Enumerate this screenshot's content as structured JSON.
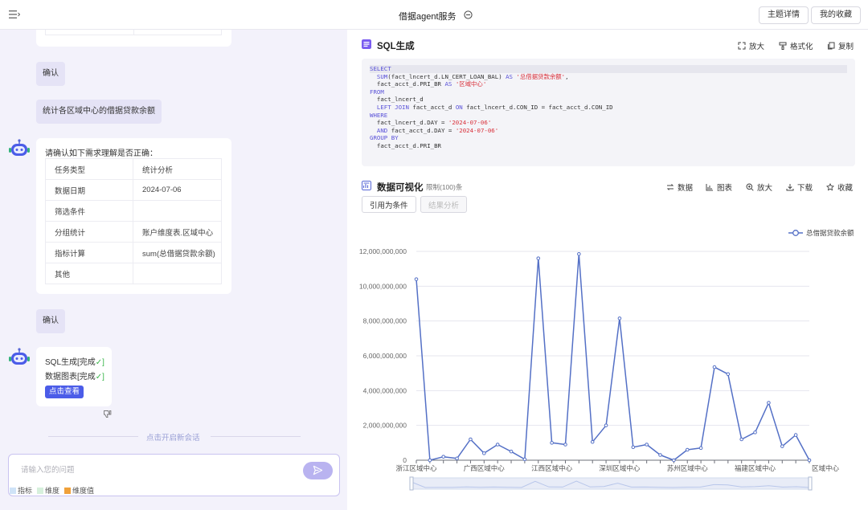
{
  "header": {
    "title": "借据agent服务",
    "topic_details_label": "主题详情",
    "my_favorites_label": "我的收藏"
  },
  "chat": {
    "confirm_1": "确认",
    "user_query": "统计各区域中心的借据贷款余额",
    "bot_prompt": "请确认如下需求理解是否正确：",
    "requirements": [
      {
        "key": "任务类型",
        "value": "统计分析"
      },
      {
        "key": "数据日期",
        "value": "2024-07-06"
      },
      {
        "key": "筛选条件",
        "value": ""
      },
      {
        "key": "分组统计",
        "value": "账户维度表.区域中心"
      },
      {
        "key": "指标计算",
        "value": "sum(总借据贷款余额)"
      },
      {
        "key": "其他",
        "value": ""
      }
    ],
    "confirm_2": "确认",
    "status_sql": "SQL生成[完成",
    "status_chart": "数据图表[完成",
    "check_mark": "✓]",
    "view_button": "点击查看",
    "new_chat": "点击开启新会话",
    "input_placeholder": "请输入您的问题",
    "tags": [
      {
        "label": "指标",
        "color": "#cfe3f7"
      },
      {
        "label": "维度",
        "color": "#d6f0dc"
      },
      {
        "label": "维度值",
        "color": "#f0a13a"
      }
    ]
  },
  "sql_section": {
    "title": "SQL生成",
    "tools": {
      "zoom": "放大",
      "format": "格式化",
      "copy": "复制"
    },
    "code_lines": [
      [
        [
          "kw",
          "SELECT"
        ]
      ],
      [
        [
          "t",
          "  "
        ],
        [
          "kw",
          "SUM"
        ],
        [
          "t",
          "(fact_lncert_d.LN_CERT_LOAN_BAL) "
        ],
        [
          "kw",
          "AS"
        ],
        [
          "t",
          " "
        ],
        [
          "str",
          "'总借据贷款余额'"
        ],
        [
          "t",
          ","
        ]
      ],
      [
        [
          "t",
          "  fact_acct_d.PRI_BR "
        ],
        [
          "kw",
          "AS"
        ],
        [
          "t",
          " "
        ],
        [
          "str",
          "'区域中心'"
        ]
      ],
      [
        [
          "kw",
          "FROM"
        ]
      ],
      [
        [
          "t",
          "  fact_lncert_d"
        ]
      ],
      [
        [
          "t",
          "  "
        ],
        [
          "kw",
          "LEFT JOIN"
        ],
        [
          "t",
          " fact_acct_d "
        ],
        [
          "kw",
          "ON"
        ],
        [
          "t",
          " fact_lncert_d.CON_ID = fact_acct_d.CON_ID"
        ]
      ],
      [
        [
          "kw",
          "WHERE"
        ]
      ],
      [
        [
          "t",
          "  fact_lncert_d.DAY = "
        ],
        [
          "str",
          "'2024-07-06'"
        ]
      ],
      [
        [
          "t",
          "  "
        ],
        [
          "kw",
          "AND"
        ],
        [
          "t",
          " fact_acct_d.DAY = "
        ],
        [
          "str",
          "'2024-07-06'"
        ]
      ],
      [
        [
          "kw",
          "GROUP BY"
        ]
      ],
      [
        [
          "t",
          "  fact_acct_d.PRI_BR"
        ]
      ]
    ]
  },
  "viz_section": {
    "title": "数据可视化",
    "limit_note": "限制(100)条",
    "tools": {
      "data": "数据",
      "chart": "图表",
      "zoom": "放大",
      "download": "下载",
      "favorite": "收藏"
    },
    "cite_button": "引用为条件",
    "analyze_button": "结果分析"
  },
  "chart_data": {
    "type": "line",
    "series": [
      {
        "name": "总借据贷款余额",
        "color": "#5470c6",
        "values": [
          10400000000,
          0,
          200000000,
          100000000,
          1200000000,
          400000000,
          900000000,
          500000000,
          50000000,
          11600000000,
          1000000000,
          900000000,
          11850000000,
          1050000000,
          2000000000,
          8150000000,
          750000000,
          900000000,
          300000000,
          0,
          600000000,
          700000000,
          5350000000,
          4950000000,
          1200000000,
          1600000000,
          3300000000,
          800000000,
          1450000000,
          0
        ]
      }
    ],
    "x_tick_labels": [
      {
        "index": 0,
        "label": "浙江区域中心"
      },
      {
        "index": 5,
        "label": "广西区域中心"
      },
      {
        "index": 10,
        "label": "江西区域中心"
      },
      {
        "index": 15,
        "label": "深圳区域中心"
      },
      {
        "index": 20,
        "label": "苏州区域中心"
      },
      {
        "index": 25,
        "label": "福建区域中心"
      },
      {
        "index": 30,
        "label": "区域中心"
      }
    ],
    "y_ticks": [
      "0",
      "2,000,000,000",
      "4,000,000,000",
      "6,000,000,000",
      "8,000,000,000",
      "10,000,000,000",
      "12,000,000,000"
    ],
    "ylim": [
      0,
      12000000000
    ],
    "grid": "horizontal",
    "legend_position": "top-right"
  }
}
